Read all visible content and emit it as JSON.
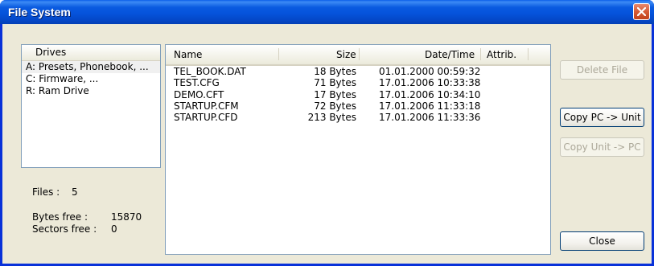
{
  "window": {
    "title": "File System"
  },
  "drives": {
    "header": "Drives",
    "items": [
      {
        "label": "A: Presets, Phonebook, ..."
      },
      {
        "label": "C: Firmware, ..."
      },
      {
        "label": "R: Ram Drive"
      }
    ]
  },
  "files": {
    "columns": {
      "name": "Name",
      "size": "Size",
      "datetime": "Date/Time",
      "attrib": "Attrib."
    },
    "rows": [
      {
        "name": "TEL_BOOK.DAT",
        "size": "18 Bytes",
        "datetime": "01.01.2000 00:59:32",
        "attrib": ""
      },
      {
        "name": "TEST.CFG",
        "size": "71 Bytes",
        "datetime": "17.01.2006 10:33:38",
        "attrib": ""
      },
      {
        "name": "DEMO.CFT",
        "size": "17 Bytes",
        "datetime": "17.01.2006 10:34:10",
        "attrib": ""
      },
      {
        "name": "STARTUP.CFM",
        "size": "72 Bytes",
        "datetime": "17.01.2006 11:33:18",
        "attrib": ""
      },
      {
        "name": "STARTUP.CFD",
        "size": "213 Bytes",
        "datetime": "17.01.2006 11:33:36",
        "attrib": ""
      }
    ]
  },
  "info": {
    "files_label": "Files :",
    "files_value": "5",
    "bytes_free_label": "Bytes free :",
    "bytes_free_value": "15870",
    "sectors_free_label": "Sectors free :",
    "sectors_free_value": "0"
  },
  "buttons": {
    "delete_file": "Delete File",
    "copy_pc_to_unit": "Copy PC -> Unit",
    "copy_unit_to_pc": "Copy Unit -> PC",
    "close": "Close"
  },
  "colors": {
    "titlebar": "#0553DC",
    "close_button": "#D55A35",
    "dialog_bg": "#ECE9D8",
    "panel_border": "#7F9DB9",
    "disabled_text": "#ACA899"
  }
}
